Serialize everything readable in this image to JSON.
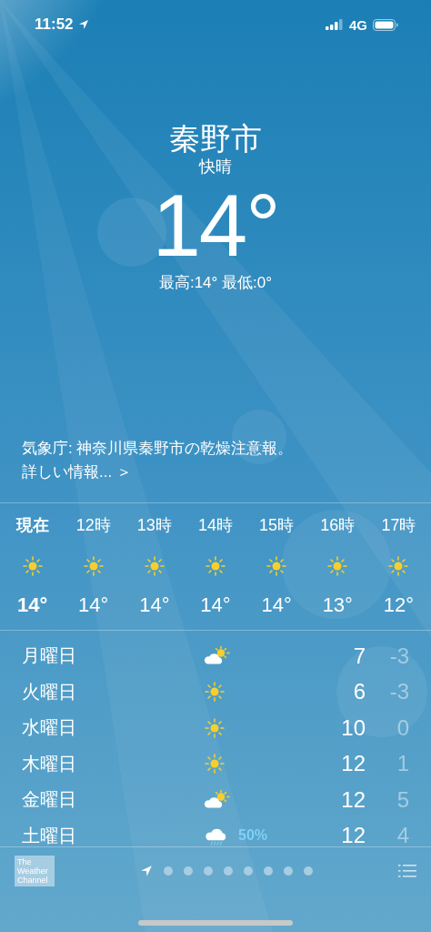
{
  "status_bar": {
    "time": "11:52",
    "network": "4G"
  },
  "location": {
    "city": "秦野市",
    "condition": "快晴",
    "temperature": "14°",
    "high_low": "最高:14° 最低:0°"
  },
  "alert": {
    "text": "気象庁: 神奈川県秦野市の乾燥注意報。",
    "link": "詳しい情報... ＞"
  },
  "hourly": [
    {
      "time": "現在",
      "kind": "sun",
      "temp": "14°",
      "selected": true
    },
    {
      "time": "12時",
      "kind": "sun",
      "temp": "14°",
      "selected": false
    },
    {
      "time": "13時",
      "kind": "sun",
      "temp": "14°",
      "selected": false
    },
    {
      "time": "14時",
      "kind": "sun",
      "temp": "14°",
      "selected": false
    },
    {
      "time": "15時",
      "kind": "sun",
      "temp": "14°",
      "selected": false
    },
    {
      "time": "16時",
      "kind": "sun",
      "temp": "13°",
      "selected": false
    },
    {
      "time": "17時",
      "kind": "sun",
      "temp": "12°",
      "selected": false
    }
  ],
  "daily": [
    {
      "day": "月曜日",
      "kind": "partly_cloudy",
      "high": "7",
      "low": "-3"
    },
    {
      "day": "火曜日",
      "kind": "sun",
      "high": "6",
      "low": "-3"
    },
    {
      "day": "水曜日",
      "kind": "sun",
      "high": "10",
      "low": "0"
    },
    {
      "day": "木曜日",
      "kind": "sun",
      "high": "12",
      "low": "1"
    },
    {
      "day": "金曜日",
      "kind": "partly_cloudy",
      "high": "12",
      "low": "5"
    },
    {
      "day": "土曜日",
      "kind": "rain",
      "precip": "50%",
      "high": "12",
      "low": "4"
    }
  ],
  "footer": {
    "logo": "The Weather Channel",
    "pages": [
      {
        "kind": "location",
        "selected": true
      },
      {
        "kind": "dot",
        "selected": false
      },
      {
        "kind": "dot",
        "selected": false
      },
      {
        "kind": "dot",
        "selected": false
      },
      {
        "kind": "dot",
        "selected": false
      },
      {
        "kind": "dot",
        "selected": false
      },
      {
        "kind": "dot",
        "selected": false
      },
      {
        "kind": "dot",
        "selected": false
      },
      {
        "kind": "dot",
        "selected": false
      }
    ]
  }
}
